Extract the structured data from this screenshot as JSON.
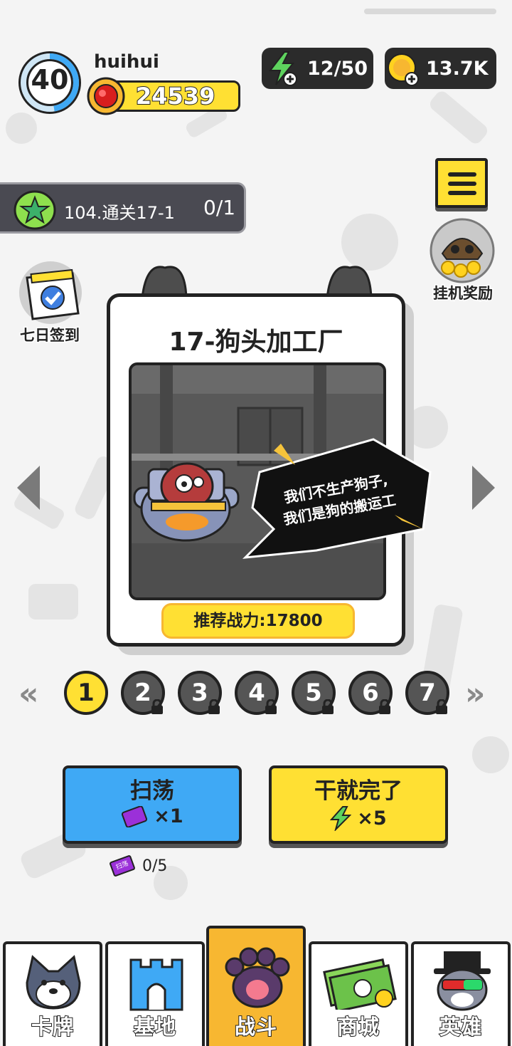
{
  "player": {
    "level": "40",
    "name": "huihui",
    "power": "24539"
  },
  "resources": {
    "energy": "12/50",
    "coins": "13.7K"
  },
  "quest": {
    "text": "104.通关17-1",
    "progress": "0/1"
  },
  "side": {
    "checkin_label": "七日签到",
    "idle_reward_label": "挂机奖励"
  },
  "stage_card": {
    "title": "17-狗头加工厂",
    "speech_line1": "我们不生产狗子,",
    "speech_line2": "我们是狗的搬运工",
    "recommended_power": "推荐战力:17800"
  },
  "stage_selector": {
    "prev_glyph": "«",
    "next_glyph": "»",
    "stages": [
      {
        "num": "1",
        "locked": false,
        "selected": true
      },
      {
        "num": "2",
        "locked": true,
        "selected": false
      },
      {
        "num": "3",
        "locked": true,
        "selected": false
      },
      {
        "num": "4",
        "locked": true,
        "selected": false
      },
      {
        "num": "5",
        "locked": true,
        "selected": false
      },
      {
        "num": "6",
        "locked": true,
        "selected": false
      },
      {
        "num": "7",
        "locked": true,
        "selected": false
      }
    ]
  },
  "actions": {
    "sweep_label": "扫荡",
    "sweep_cost": "×1",
    "fight_label": "干就完了",
    "fight_cost": "×5",
    "ticket_word": "扫荡",
    "ticket_count": "0/5"
  },
  "nav": {
    "items": [
      {
        "label": "卡牌",
        "active": false
      },
      {
        "label": "基地",
        "active": false
      },
      {
        "label": "战斗",
        "active": true
      },
      {
        "label": "商城",
        "active": false
      },
      {
        "label": "英雄",
        "active": false
      }
    ]
  },
  "colors": {
    "yellow": "#ffe033",
    "blue": "#3fa9f5",
    "dark": "#2b2b2b",
    "orange": "#f7b731",
    "purple": "#9b30d9",
    "green": "#5ed35e"
  }
}
